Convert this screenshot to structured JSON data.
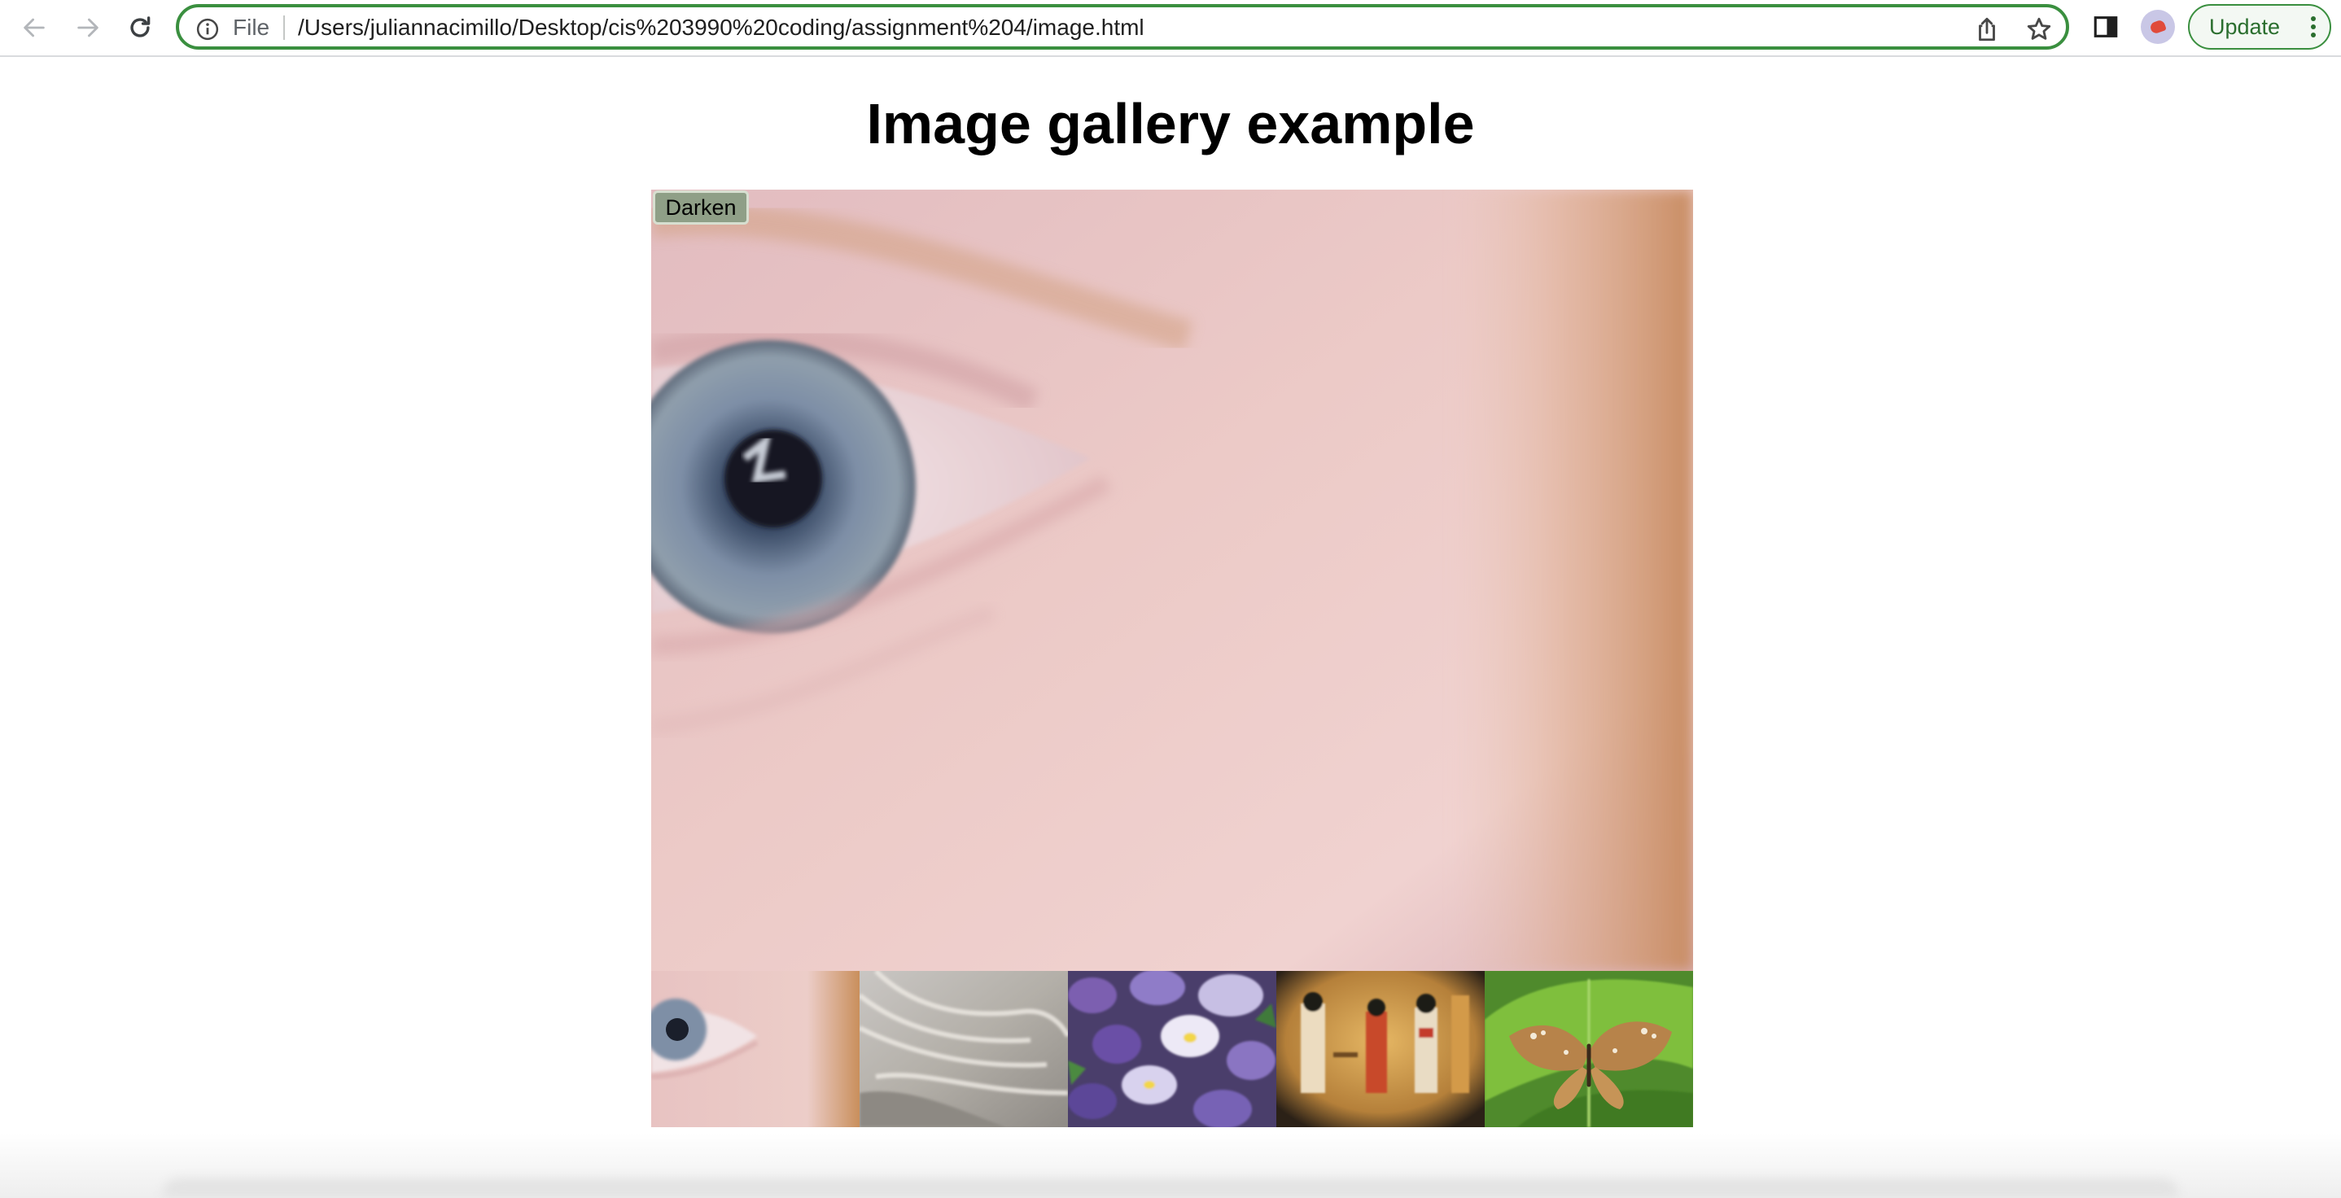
{
  "browser": {
    "scheme_label": "File",
    "url": "/Users/juliannacimillo/Desktop/cis%203990%20coding/assignment%204/image.html",
    "update_label": "Update"
  },
  "page": {
    "title": "Image gallery example",
    "darken_label": "Darken"
  },
  "gallery": {
    "thumbnails": [
      {
        "name": "eye-thumbnail"
      },
      {
        "name": "rock-thumbnail"
      },
      {
        "name": "flowers-thumbnail"
      },
      {
        "name": "egypt-thumbnail"
      },
      {
        "name": "butterfly-thumbnail"
      }
    ]
  }
}
